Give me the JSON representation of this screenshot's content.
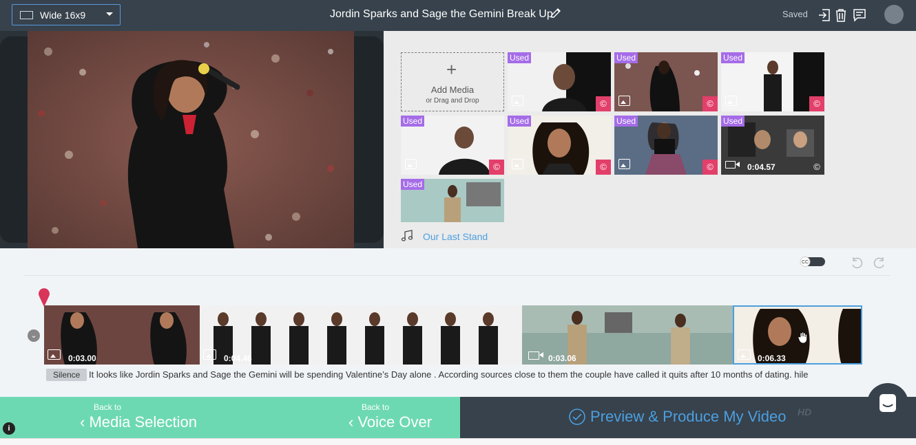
{
  "header": {
    "aspect_label": "Wide 16x9",
    "project_title": "Jordin Sparks and Sage the Gemini Break Up",
    "status": "Saved"
  },
  "media_panel": {
    "add_media_title": "Add Media",
    "add_media_subtitle": "or Drag and Drop",
    "used_label": "Used",
    "tiles": [
      {
        "used": "Used",
        "kind": "image",
        "copyright": "©"
      },
      {
        "used": "Used",
        "kind": "image",
        "copyright": "©"
      },
      {
        "used": "Used",
        "kind": "image",
        "copyright": "©"
      },
      {
        "used": "Used",
        "kind": "image",
        "copyright": "©"
      },
      {
        "used": "Used",
        "kind": "image",
        "copyright": "©"
      },
      {
        "used": "Used",
        "kind": "image",
        "copyright": "©"
      },
      {
        "used": "Used",
        "kind": "video",
        "duration": "0:04.57",
        "copyright": "©"
      },
      {
        "used": "Used",
        "kind": "image"
      }
    ],
    "music_track": "Our Last Stand"
  },
  "timeline": {
    "cc_label": "CC",
    "clips": [
      {
        "kind": "image",
        "duration": "0:03.00"
      },
      {
        "kind": "image",
        "duration": "0:04.46"
      },
      {
        "kind": "video",
        "duration": "0:03.06"
      },
      {
        "kind": "image",
        "duration": "0:06.33"
      }
    ],
    "silence_label": "Silence",
    "script_text": "It looks like Jordin Sparks and Sage the Gemini will be spending Valentine’s Day alone . According sources close to them the couple have called it quits after 10 months of dating. hile"
  },
  "footer": {
    "back_small": "Back to",
    "back_media": "Media Selection",
    "back_voice": "Voice Over",
    "produce_label": "Preview & Produce My Video",
    "hd_badge": "HD"
  },
  "colors": {
    "accent": "#4b9fe0",
    "used_badge": "#a56ce8",
    "copyright_badge": "#e23f6a",
    "back_buttons": "#6dd9b3",
    "dark_bar": "#37424c"
  }
}
